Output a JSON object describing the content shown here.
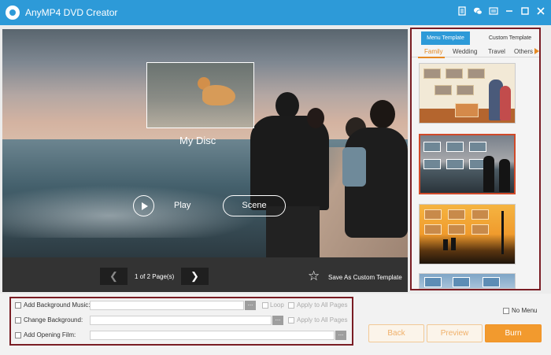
{
  "app": {
    "title": "AnyMP4 DVD Creator"
  },
  "window_icons": [
    "document-icon",
    "chat-icon",
    "menu-icon",
    "minimize-icon",
    "close-icon"
  ],
  "preview": {
    "disc_title": "My Disc",
    "play_label": "Play",
    "scene_label": "Scene",
    "page_info": "1 of 2 Page(s)",
    "save_template_label": "Save As Custom Template"
  },
  "sidebar": {
    "tabs": [
      {
        "label": "Menu Template",
        "active": true
      },
      {
        "label": "Custom Template",
        "active": false
      }
    ],
    "categories": [
      {
        "label": "Family",
        "active": true
      },
      {
        "label": "Wedding",
        "active": false
      },
      {
        "label": "Travel",
        "active": false
      },
      {
        "label": "Others",
        "active": false
      }
    ],
    "selected_template_index": 1
  },
  "options": {
    "background_music": {
      "label": "Add Background Music:",
      "value": "",
      "loop_label": "Loop",
      "apply_label": "Apply to All Pages",
      "checked": false
    },
    "background": {
      "label": "Change Background:",
      "value": "",
      "apply_label": "Apply to All Pages",
      "checked": false
    },
    "opening_film": {
      "label": "Add Opening Film:",
      "value": "",
      "checked": false
    },
    "browse_label": "...",
    "no_menu_label": "No Menu"
  },
  "buttons": {
    "back": "Back",
    "preview": "Preview",
    "burn": "Burn"
  },
  "colors": {
    "titlebar": "#2d9ad8",
    "accent": "#f29a2e",
    "highlight_border": "#7a1d24"
  }
}
